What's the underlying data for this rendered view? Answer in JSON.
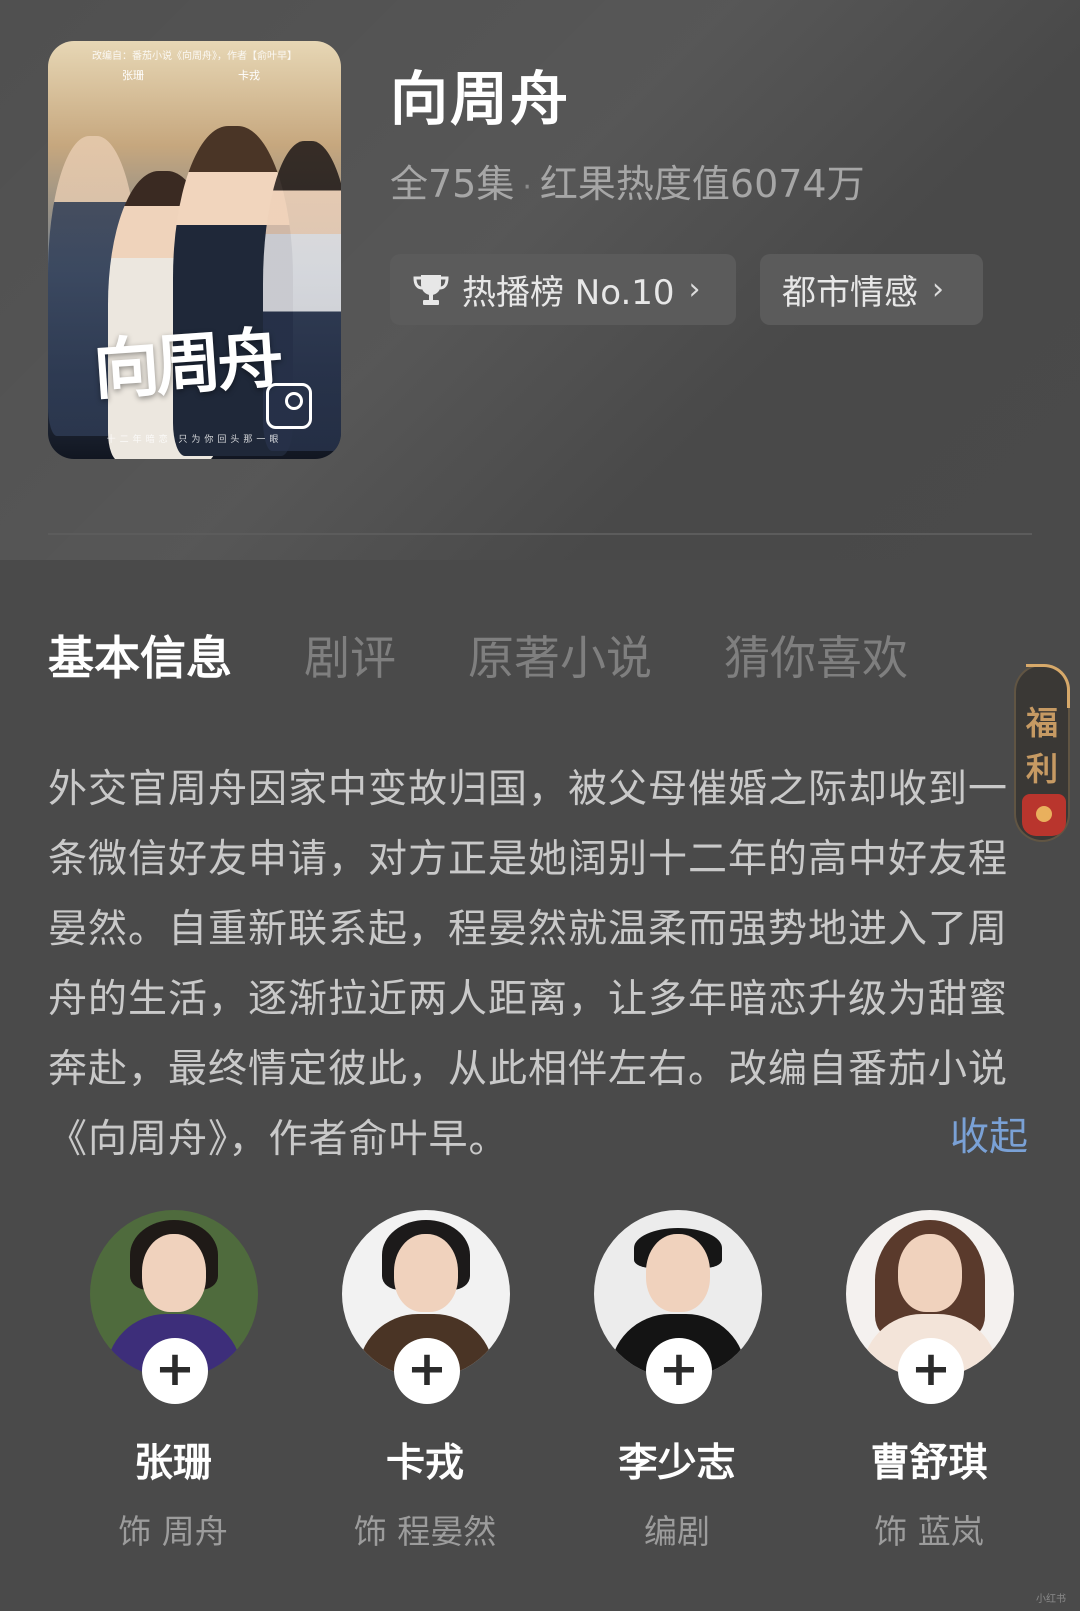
{
  "poster": {
    "top_line": "改编自：番茄小说《向周舟》，作者【俞叶早】",
    "cast_left": "张珊",
    "cast_right": "卡戎",
    "logo": "向周舟",
    "tagline": "十二年暗恋 只为你回头那一眼"
  },
  "show": {
    "title": "向周舟",
    "episodes": "全75集",
    "separator": "·",
    "heat": "红果热度值6074万"
  },
  "chips": {
    "rank_label": "热播榜 No.10",
    "genre_label": "都市情感",
    "arrow": "›"
  },
  "tabs": [
    {
      "label": "基本信息",
      "active": true
    },
    {
      "label": "剧评",
      "active": false
    },
    {
      "label": "原著小说",
      "active": false
    },
    {
      "label": "猜你喜欢",
      "active": false
    }
  ],
  "side_widget": {
    "label": "福利"
  },
  "description": {
    "text": "外交官周舟因家中变故归国，被父母催婚之际却收到一条微信好友申请，对方正是她阔别十二年的高中好友程晏然。自重新联系起，程晏然就温柔而强势地进入了周舟的生活，逐渐拉近两人距离，让多年暗恋升级为甜蜜奔赴，最终情定彼此，从此相伴左右。改编自番茄小说《向周舟》，作者俞叶早。",
    "collapse_label": "收起"
  },
  "cast": [
    {
      "name": "张珊",
      "role": "饰 周舟",
      "follow": "+"
    },
    {
      "name": "卡戎",
      "role": "饰 程晏然",
      "follow": "+"
    },
    {
      "name": "李少志",
      "role": "编剧",
      "follow": "+"
    },
    {
      "name": "曹舒琪",
      "role": "饰 蓝岚",
      "follow": "+"
    }
  ],
  "colors": {
    "background": "#4a4a4a",
    "chip": "#5b5b5b",
    "link": "#7aa1d6",
    "muted_text": "#a6a6a6",
    "fuli_gold": "#c69a63"
  },
  "watermark": "小红书"
}
